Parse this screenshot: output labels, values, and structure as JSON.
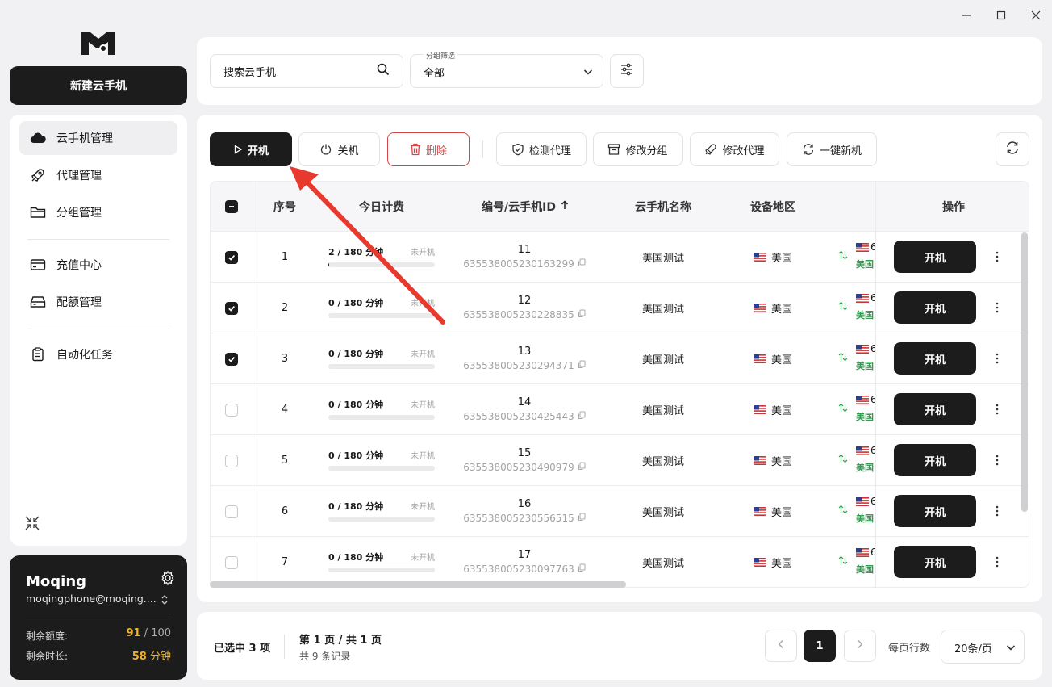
{
  "window": {
    "minimize": "—",
    "maximize": "☐",
    "close": "✕"
  },
  "sidebar": {
    "new_button": "新建云手机",
    "items": [
      {
        "label": "云手机管理",
        "icon": "cloud-icon",
        "active": true
      },
      {
        "label": "代理管理",
        "icon": "rocket-icon",
        "active": false
      },
      {
        "label": "分组管理",
        "icon": "folder-icon",
        "active": false
      },
      {
        "label": "充值中心",
        "icon": "card-icon",
        "active": false
      },
      {
        "label": "配额管理",
        "icon": "drive-icon",
        "active": false
      },
      {
        "label": "自动化任务",
        "icon": "clipboard-icon",
        "active": false
      }
    ]
  },
  "user": {
    "name": "Moqing",
    "email": "moqingphone@moqing....",
    "quota_label": "剩余额度:",
    "quota_used": "91",
    "quota_total": "/ 100",
    "time_label": "剩余时长:",
    "time_value": "58",
    "time_unit": "分钟"
  },
  "search": {
    "placeholder": "搜索云手机"
  },
  "group_filter": {
    "label": "分组筛选",
    "value": "全部"
  },
  "toolbar": {
    "start": "开机",
    "stop": "关机",
    "delete": "删除",
    "check_proxy": "检测代理",
    "edit_group": "修改分组",
    "edit_proxy": "修改代理",
    "one_click_new": "一键新机"
  },
  "table": {
    "headers": {
      "index": "序号",
      "today_fee": "今日计费",
      "id": "编号/云手机ID",
      "name": "云手机名称",
      "region": "设备地区",
      "ops": "操作"
    },
    "rows": [
      {
        "checked": true,
        "index": "1",
        "usage": "2 / 180 分钟",
        "usage_fraction": 0.011,
        "status": "未开机",
        "num": "11",
        "cid": "635538005230163299",
        "name": "美国测试",
        "region": "美国",
        "net_num": "6",
        "net_region": "美国",
        "action": "开机"
      },
      {
        "checked": true,
        "index": "2",
        "usage": "0 / 180 分钟",
        "usage_fraction": 0,
        "status": "未开机",
        "num": "12",
        "cid": "635538005230228835",
        "name": "美国测试",
        "region": "美国",
        "net_num": "6",
        "net_region": "美国",
        "action": "开机"
      },
      {
        "checked": true,
        "index": "3",
        "usage": "0 / 180 分钟",
        "usage_fraction": 0,
        "status": "未开机",
        "num": "13",
        "cid": "635538005230294371",
        "name": "美国测试",
        "region": "美国",
        "net_num": "6",
        "net_region": "美国",
        "action": "开机"
      },
      {
        "checked": false,
        "index": "4",
        "usage": "0 / 180 分钟",
        "usage_fraction": 0,
        "status": "未开机",
        "num": "14",
        "cid": "635538005230425443",
        "name": "美国测试",
        "region": "美国",
        "net_num": "6",
        "net_region": "美国",
        "action": "开机"
      },
      {
        "checked": false,
        "index": "5",
        "usage": "0 / 180 分钟",
        "usage_fraction": 0,
        "status": "未开机",
        "num": "15",
        "cid": "635538005230490979",
        "name": "美国测试",
        "region": "美国",
        "net_num": "6",
        "net_region": "美国",
        "action": "开机"
      },
      {
        "checked": false,
        "index": "6",
        "usage": "0 / 180 分钟",
        "usage_fraction": 0,
        "status": "未开机",
        "num": "16",
        "cid": "635538005230556515",
        "name": "美国测试",
        "region": "美国",
        "net_num": "6",
        "net_region": "美国",
        "action": "开机"
      },
      {
        "checked": false,
        "index": "7",
        "usage": "0 / 180 分钟",
        "usage_fraction": 0,
        "status": "未开机",
        "num": "17",
        "cid": "635538005230097763",
        "name": "美国测试",
        "region": "美国",
        "net_num": "6",
        "net_region": "美国",
        "action": "开机"
      }
    ]
  },
  "footer": {
    "selected": "已选中 3 项",
    "page_info": "第 1 页 / 共 1 页",
    "records": "共 9 条记录",
    "current_page": "1",
    "rows_per_page_label": "每页行数",
    "rows_per_page_value": "20条/页"
  },
  "colors": {
    "accent": "#1c1c1c",
    "danger": "#d64545",
    "quota": "#f0b429",
    "success": "#3a9a55",
    "annotation": "#e8392f"
  }
}
